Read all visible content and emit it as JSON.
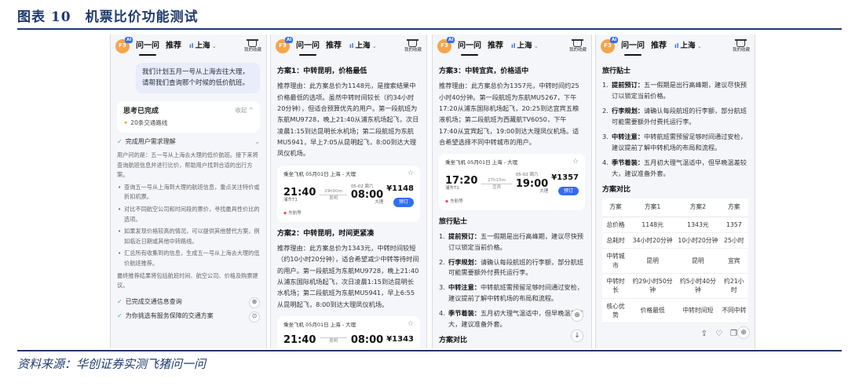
{
  "figure": {
    "title": "图表 10　机票比价功能测试",
    "source": "资料来源：华创证券实测飞猪问一问"
  },
  "topbar": {
    "avatar_text": "F3",
    "ai_badge": "AI",
    "tab_ask": "问一问",
    "tab_recommend": "推荐",
    "location": "上海",
    "favorites_label": "我的收藏"
  },
  "panel1": {
    "user_query": "我们计划五月一号从上海去往大理，请帮我们查询那个时候的低价航班。",
    "thinking_title": "思考已完成",
    "thinking_fold": "收起 ^",
    "thinking_subtitle": "20条交通路线",
    "step1": "完成用户需求理解",
    "intro": "用户问的是：五一号从上海去大理的低价航班。接下来将查询航班信息并进行比价，帮助用户找到合适的出行方案。",
    "bullets": [
      "查询五一号从上海到大理的航班信息，重点关注特价或折扣机票。",
      "对比不同航空公司和时间段的票价，寻找最具性价比的选项。",
      "如果发现价格较高的情况，可以提供其他替代方案，例如临近日期或其他中转路线。",
      "汇总所有收集到的信息，生成五一号从上海去大理的低价航班推荐。"
    ],
    "closing": "最终推荐结果将包括航班时间、航空公司、价格及购票建议。",
    "step2": "已完成交通信息查询",
    "step3": "为你挑选有服务保障的交通方案"
  },
  "panel2": {
    "plan1_title": "方案1：中转昆明，价格最低",
    "plan1_text": "推荐理由：此方案总价为1148元，是搜索结果中价格最低的选项。虽然中转时间较长（约34小时20分钟），但适合预算优先的用户。第一段航班为东航MU9728，晚上21:40从浦东机场起飞，次日凌晨1:15到达昆明长水机场；第二段航班为东航MU5941，早上7:05从昆明起飞，8:00到达大理凤仪机场。",
    "card1": {
      "header": "乘坐飞机 05月01日 上海 - 大理",
      "dep_time": "21:40",
      "dep_airport": "浦东T1",
      "dep_duration": "29h00m",
      "via": "昆明",
      "arr_time": "08:00",
      "arr_date": "05-02 周六",
      "arr_airport": "大理",
      "price": "¥1148",
      "book": "预订",
      "airline": "东航等"
    },
    "plan2_title": "方案2：中转昆明，时间更紧凑",
    "plan2_text": "推荐理由：此方案总价为1343元，中转时间较短（约10小时20分钟），适合希望减少中转等待时间的用户。第一段航班为东航MU9728，晚上21:40从浦东国际机场起飞，次日凌晨1:15到达昆明长水机场；第二段航班为东航MU5941，早上6:55从昆明起飞，8:00到达大理凤仪机场。",
    "card2": {
      "header": "乘坐飞机 05月01日 上海 - 大理",
      "dep_time": "21:40",
      "via": "昆明",
      "arr_time": "08:00",
      "arr_date": "05-02 周六",
      "price": "¥1343"
    }
  },
  "panel3": {
    "plan3_title": "方案3：中转宜宾，价格适中",
    "plan3_text": "推荐理由：此方案总价为1357元，中转时间约25小时40分钟。第一段航班为东航MU5267，下午17:20从浦东国际机场起飞，20:25到达宜宾五粮液机场；第二段航班为西藏航TV6050，下午17:40从宜宾起飞，19:00到达大理凤仪机场。适合希望选择不同中转城市的用户。",
    "card": {
      "header": "乘坐飞机 05月01日 上海 - 大理",
      "dep_time": "17:20",
      "dep_airport": "浦东T1",
      "dep_duration": "27h15m",
      "via": "宜宾",
      "arr_time": "19:00",
      "arr_date": "05-02 周六",
      "arr_airport": "大理",
      "price": "¥1357",
      "book": "预订",
      "airline": "东航等"
    },
    "tips_title": "旅行贴士",
    "tips": [
      {
        "head": "提前预订：",
        "text": "五一假期是出行高峰期，建议尽快预订以锁定当前价格。"
      },
      {
        "head": "行李规划：",
        "text": "请确认每段航班的行李额，部分航班可能需要额外付费托运行李。"
      },
      {
        "head": "中转注意：",
        "text": "中转航班需预留足够时间通过安检，建议提前了解中转机场的布局和流程。"
      },
      {
        "head": "季节着装：",
        "text": "五月初大理气温适中，但早晚温差较大，建议准备外套。"
      }
    ],
    "compare_title": "方案对比"
  },
  "panel4": {
    "tips_title": "旅行贴士",
    "tips": [
      {
        "head": "提前预订：",
        "text": "五一假期是出行高峰期，建议尽快预订以锁定当前价格。"
      },
      {
        "head": "行李规划：",
        "text": "请确认每段航班的行李额，部分航班可能需要额外付费托运行李。"
      },
      {
        "head": "中转注意：",
        "text": "中转航班需预留足够时间通过安检，建议提前了解中转机场的布局和流程。"
      },
      {
        "head": "季节着装：",
        "text": "五月初大理气温适中，但早晚温差较大，建议准备外套。"
      }
    ],
    "compare_title": "方案对比",
    "table": {
      "headers": [
        "方案",
        "方案1",
        "方案2",
        "方案"
      ],
      "rows": [
        [
          "总价格",
          "1148元",
          "1343元",
          "1357"
        ],
        [
          "总耗时",
          "34小时20分钟",
          "10小时20分钟",
          "25小时"
        ],
        [
          "中转城市",
          "昆明",
          "昆明",
          "宜宾"
        ],
        [
          "中转时长",
          "约29小时50分钟",
          "约5小时40分钟",
          "约21小时"
        ],
        [
          "核心优势",
          "价格最低",
          "中转时间短",
          "不同中转"
        ]
      ]
    }
  }
}
